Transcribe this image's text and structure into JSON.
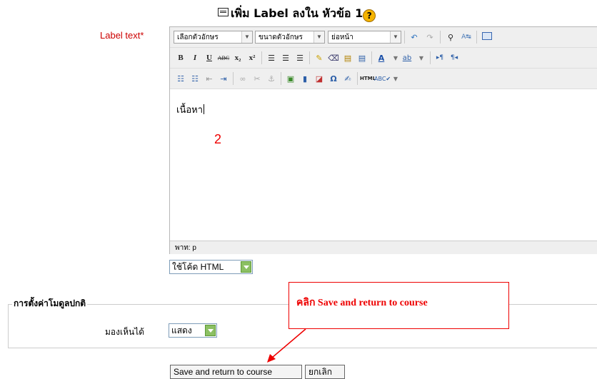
{
  "header": {
    "title": "เพิ่ม Label ลงใน หัวข้อ 1",
    "help_glyph": "?"
  },
  "form": {
    "label_text": "Label text",
    "required_mark": "*",
    "editor": {
      "font_family_placeholder": "เลือกตัวอักษร",
      "font_size_placeholder": "ขนาดตัวอักษร",
      "format_placeholder": "ย่อหน้า",
      "toolbar_row2": [
        "B",
        "I",
        "U",
        "ABC",
        "x₂",
        "x²"
      ],
      "content": "เนื้อหา",
      "path": "พาท: p"
    },
    "format_select_value": "ใช้โค้ด HTML"
  },
  "settings": {
    "legend": "การตั้งค่าโมดูลปกติ",
    "visible_label": "มองเห็นได้",
    "visible_value": "แสดง"
  },
  "annotations": {
    "step_number": "2",
    "callout": "คลิก Save and return to course",
    "color": "#ee0000"
  },
  "actions": {
    "save_label": "Save and return to course",
    "cancel_label": "ยกเลิก"
  }
}
